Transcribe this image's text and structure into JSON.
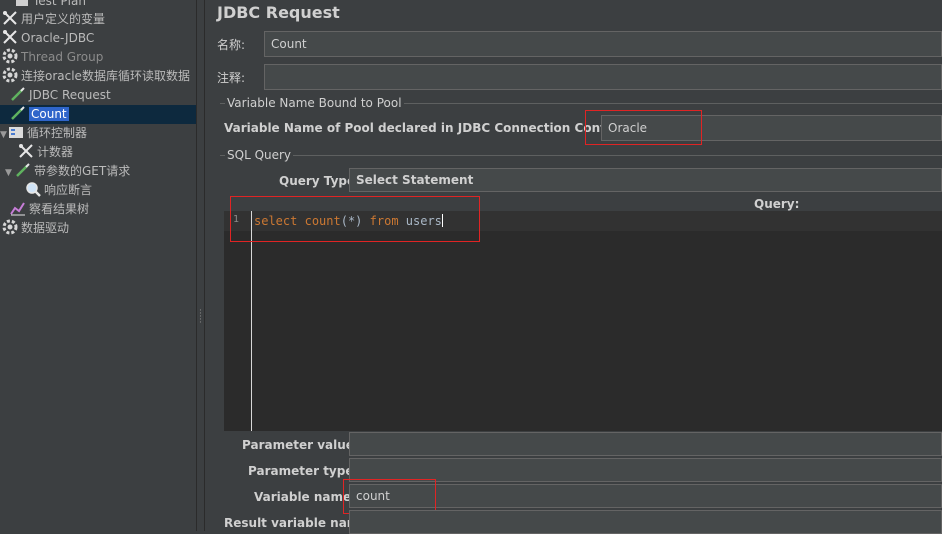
{
  "tree": {
    "items": [
      {
        "label": "Test Plan",
        "icon": "test-plan-icon"
      },
      {
        "label": "用户定义的变量",
        "icon": "wrench-icon"
      },
      {
        "label": "Oracle-JDBC",
        "icon": "wrench-icon"
      },
      {
        "label": "Thread Group",
        "icon": "gear-icon"
      },
      {
        "label": "连接oracle数据库循环读取数据",
        "icon": "gear-icon"
      },
      {
        "label": "JDBC Request",
        "icon": "pipette-icon"
      },
      {
        "label": "Count",
        "icon": "pipette-icon"
      },
      {
        "label": "循环控制器",
        "icon": "loop-controller-icon"
      },
      {
        "label": "计数器",
        "icon": "wrench-icon"
      },
      {
        "label": "带参数的GET请求",
        "icon": "pipette-icon"
      },
      {
        "label": "响应断言",
        "icon": "magnifier-icon"
      },
      {
        "label": "察看结果树",
        "icon": "chart-icon"
      },
      {
        "label": "数据驱动",
        "icon": "gear-icon"
      }
    ]
  },
  "panel": {
    "title": "JDBC Request",
    "name_label": "名称:",
    "name_value": "Count",
    "comment_label": "注释:",
    "comment_value": "",
    "pool_section_title": "Variable Name Bound to Pool",
    "pool_label": "Variable Name of Pool declared in JDBC Connection Configuration:",
    "pool_value": "Oracle",
    "sql_section_title": "SQL Query",
    "query_type_label": "Query Type:",
    "query_type_value": "Select Statement",
    "query_label": "Query:",
    "line_number": "1",
    "code": {
      "kw1": "select",
      "fn": "count",
      "args": "(*)",
      "kw2": "from",
      "table": "users"
    },
    "param_values_label": "Parameter values:",
    "param_values_value": "",
    "param_types_label": "Parameter types:",
    "param_types_value": "",
    "var_names_label": "Variable names:",
    "var_names_value": "count",
    "result_var_label": "Result variable name:",
    "result_var_value": ""
  },
  "colors": {
    "background": "#3c3f41",
    "selection": "#2f65ca",
    "highlight_box": "#e02424",
    "keyword": "#cc7832"
  }
}
